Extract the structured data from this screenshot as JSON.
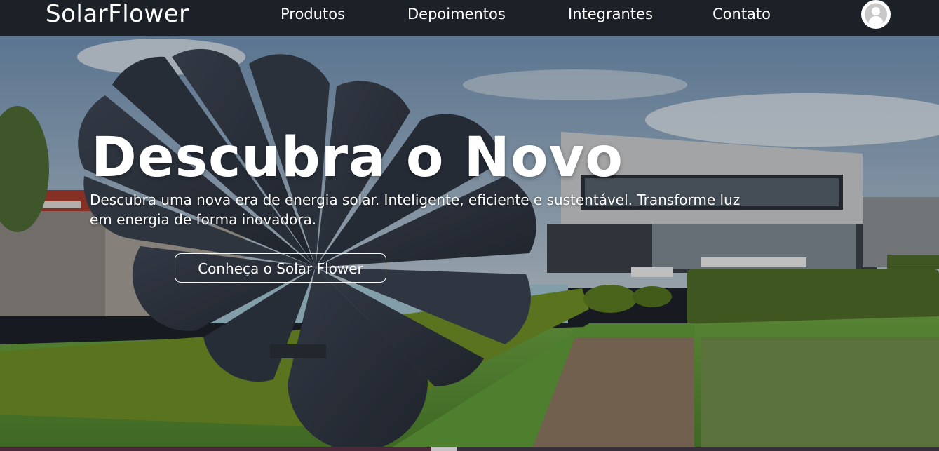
{
  "navbar": {
    "brand": "SolarFlower",
    "links": [
      "Produtos",
      "Depoimentos",
      "Integrantes",
      "Contato"
    ],
    "avatar_icon": "user-avatar-icon"
  },
  "hero": {
    "title": "Descubra o Novo",
    "text": "Descubra uma nova era de energia solar. Inteligente, eficiente e sustentável. Transforme luz em energia de forma inovadora.",
    "button_label": "Conheça o Solar Flower"
  },
  "colors": {
    "navbar_bg": "#1c2128",
    "text": "#ffffff",
    "sky": "#7f9fbe",
    "grass": "#5f8f3c",
    "hedge": "#6f8f2c"
  }
}
